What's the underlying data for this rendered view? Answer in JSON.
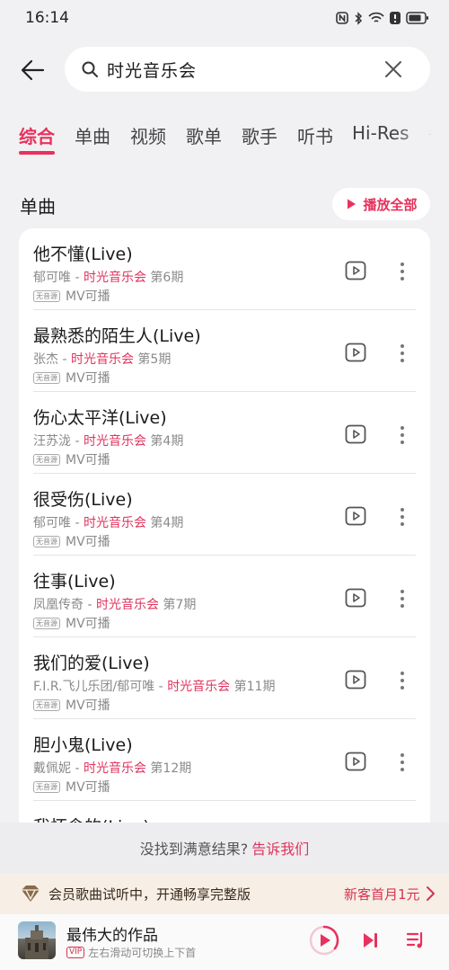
{
  "status_bar": {
    "time": "16:14"
  },
  "search": {
    "query": "时光音乐会"
  },
  "tabs": [
    {
      "label": "综合"
    },
    {
      "label": "单曲"
    },
    {
      "label": "视频"
    },
    {
      "label": "歌单"
    },
    {
      "label": "歌手"
    },
    {
      "label": "听书"
    },
    {
      "label": "Hi-Res"
    },
    {
      "label": "专"
    }
  ],
  "section": {
    "title": "单曲",
    "play_all_label": "播放全部"
  },
  "songs": [
    {
      "title": "他不懂(Live)",
      "artist": "郁可唯",
      "separator": " - ",
      "album": "时光音乐会",
      "episode": "第6期",
      "badge": "无音源",
      "mv_label": "MV可播"
    },
    {
      "title": "最熟悉的陌生人(Live)",
      "artist": "张杰",
      "separator": " - ",
      "album": "时光音乐会",
      "episode": "第5期",
      "badge": "无音源",
      "mv_label": "MV可播"
    },
    {
      "title": "伤心太平洋(Live)",
      "artist": "汪苏泷",
      "separator": " - ",
      "album": "时光音乐会",
      "episode": "第4期",
      "badge": "无音源",
      "mv_label": "MV可播"
    },
    {
      "title": "很受伤(Live)",
      "artist": "郁可唯",
      "separator": " - ",
      "album": "时光音乐会",
      "episode": "第4期",
      "badge": "无音源",
      "mv_label": "MV可播"
    },
    {
      "title": "往事(Live)",
      "artist": "凤凰传奇",
      "separator": " - ",
      "album": "时光音乐会",
      "episode": "第7期",
      "badge": "无音源",
      "mv_label": "MV可播"
    },
    {
      "title": "我们的爱(Live)",
      "artist": "F.I.R.飞儿乐团/郁可唯",
      "separator": " - ",
      "album": "时光音乐会",
      "episode": "第11期",
      "badge": "无音源",
      "mv_label": "MV可播"
    },
    {
      "title": "胆小鬼(Live)",
      "artist": "戴佩妮",
      "separator": " - ",
      "album": "时光音乐会",
      "episode": "第12期",
      "badge": "无音源",
      "mv_label": "MV可播"
    },
    {
      "title": "我怀念的(Live)",
      "artist": "",
      "separator": "",
      "album": "",
      "episode": "",
      "badge": "",
      "mv_label": ""
    }
  ],
  "feedback": {
    "text": "没找到满意结果?",
    "link": "告诉我们"
  },
  "vip_banner": {
    "text": "会员歌曲试听中，开通畅享完整版",
    "offer": "新客首月1元"
  },
  "player": {
    "title": "最伟大的作品",
    "vip_badge": "VIP",
    "subtitle": "左右滑动可切换上下首"
  },
  "colors": {
    "accent": "#e8315c",
    "vip_bg": "#f7efe6"
  }
}
